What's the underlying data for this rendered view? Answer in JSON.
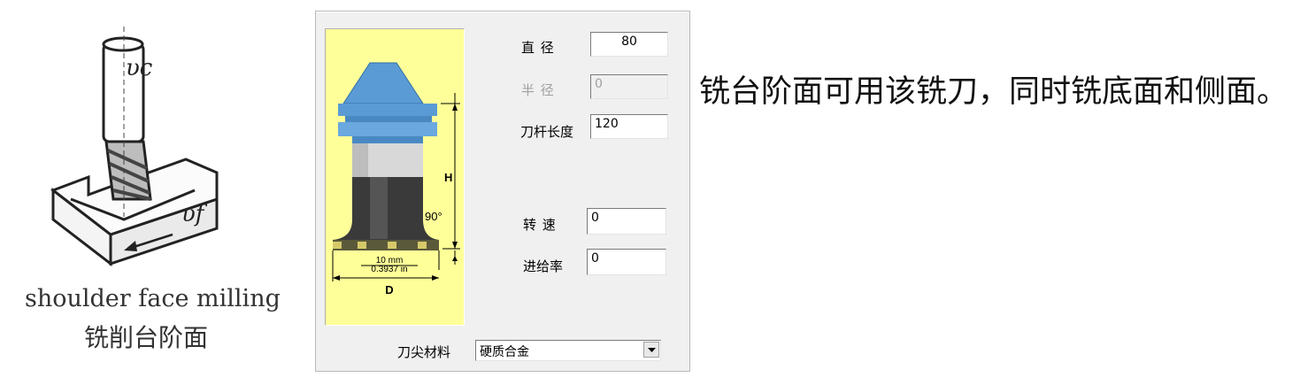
{
  "illustration": {
    "caption_en": "shoulder face milling",
    "caption_zh": "铣削台阶面",
    "label_vc": "υc",
    "label_vf": "υf"
  },
  "dialog": {
    "diameter_label": "直 径",
    "diameter_value": "80",
    "radius_label": "半 径",
    "radius_value": "0",
    "shank_length_label": "刀杆长度",
    "shank_length_value": "120",
    "speed_label": "转 速",
    "speed_value": "0",
    "feed_label": "进给率",
    "feed_value": "0",
    "tip_material_label": "刀尖材料",
    "tip_material_value": "硬质合金",
    "diagram": {
      "label_h": "H",
      "label_angle": "90°",
      "label_mm": "10 mm",
      "label_in": "0.3937 in",
      "label_d": "D"
    }
  },
  "description": "铣台阶面可用该铣刀，同时铣底面和侧面。",
  "colors": {
    "preview_bg": "#ffff99",
    "tool_holder": "#5b9bd5",
    "tool_body": "#3a3a3a"
  }
}
